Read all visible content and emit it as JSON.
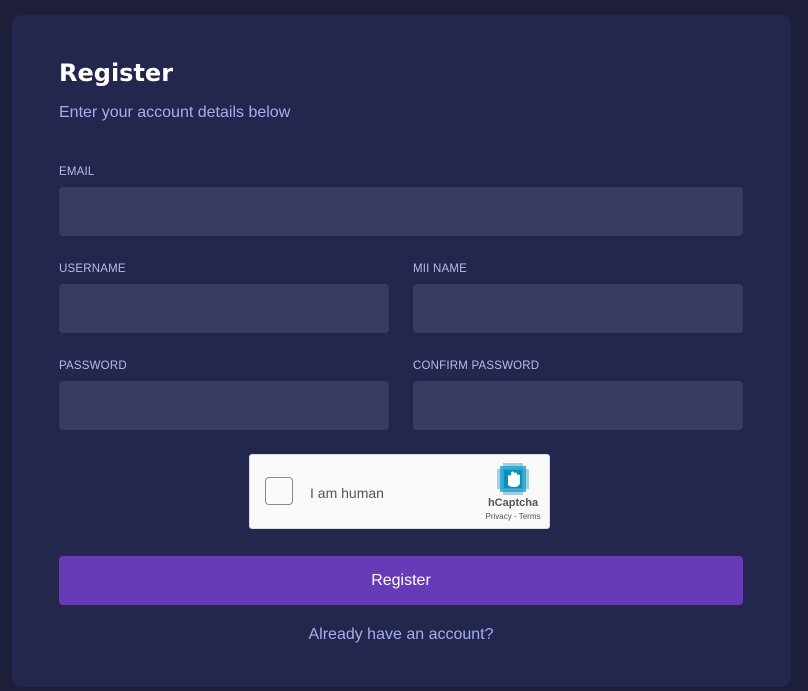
{
  "form": {
    "title": "Register",
    "subtitle": "Enter your account details below",
    "fields": {
      "email": {
        "label": "EMAIL",
        "value": "",
        "placeholder": ""
      },
      "username": {
        "label": "USERNAME",
        "value": "",
        "placeholder": ""
      },
      "mii_name": {
        "label": "MII NAME",
        "value": "",
        "placeholder": ""
      },
      "password": {
        "label": "PASSWORD",
        "value": "",
        "placeholder": ""
      },
      "confirm_password": {
        "label": "CONFIRM PASSWORD",
        "value": "",
        "placeholder": ""
      }
    },
    "captcha": {
      "label": "I am human",
      "brand": "hCaptcha",
      "privacy_link": "Privacy",
      "separator": " - ",
      "terms_link": "Terms",
      "icon": "hcaptcha-logo-icon",
      "checked": false
    },
    "submit_label": "Register",
    "login_link": "Already have an account?"
  },
  "colors": {
    "page_background": "#1c1e3a",
    "card_background": "#23264d",
    "input_background": "#393b62",
    "accent": "#673ab7",
    "muted_text": "#a9acec",
    "captcha_logo": "#1ca4c8"
  }
}
